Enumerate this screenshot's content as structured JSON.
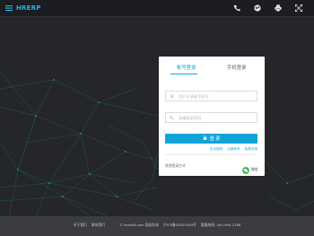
{
  "header": {
    "logo_text": "HRERP",
    "icons": [
      "phone-icon",
      "globe-icon",
      "printer-icon",
      "fullscreen-icon"
    ]
  },
  "login": {
    "tabs": [
      {
        "label": "帐号登录",
        "active": true
      },
      {
        "label": "手机登录",
        "active": false
      }
    ],
    "username_placeholder": "用户名或者手机号",
    "password_placeholder": "请输登录密码",
    "login_button": "登 录",
    "links": [
      "忘记密码",
      "注册帐号",
      "免费试用"
    ],
    "other_login_label": "其他登录方式",
    "wechat_label": "微信"
  },
  "footer": {
    "about": "关于我们",
    "contact": "联系我们",
    "copyright": "© hrosoft.com 国软科技",
    "icp": "沪ICP备05025409号",
    "hotline": "客服热线: 400-990-1188"
  },
  "colors": {
    "accent": "#12a4d8",
    "background": "#242629",
    "footer": "#3a3c40",
    "network": "#1f8f6a"
  }
}
